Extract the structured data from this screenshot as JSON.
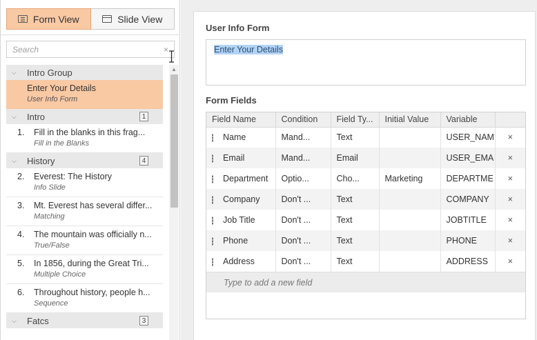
{
  "view_toggle": {
    "form_view": "Form View",
    "slide_view": "Slide View"
  },
  "search": {
    "placeholder": "Search",
    "clear": "×"
  },
  "tree": {
    "intro_group": {
      "label": "Intro Group",
      "items": [
        {
          "title": "Enter Your Details",
          "sub": "User Info Form"
        }
      ]
    },
    "intro": {
      "label": "Intro",
      "count": "1",
      "items": [
        {
          "num": "1.",
          "title": "Fill in the blanks in this frag...",
          "sub": "Fill in the Blanks"
        }
      ]
    },
    "history": {
      "label": "History",
      "count": "4",
      "items": [
        {
          "num": "2.",
          "title": "Everest: The History",
          "sub": "Info Slide"
        },
        {
          "num": "3.",
          "title": "Mt. Everest has several differ...",
          "sub": "Matching"
        },
        {
          "num": "4.",
          "title": "The mountain was officially n...",
          "sub": "True/False"
        },
        {
          "num": "5.",
          "title": "In 1856, during the Great Tri...",
          "sub": "Multiple Choice"
        },
        {
          "num": "6.",
          "title": "Throughout history, people h...",
          "sub": "Sequence"
        }
      ]
    },
    "facts": {
      "label": "Fatcs",
      "count": "3"
    }
  },
  "form": {
    "title_label": "User Info Form",
    "text_value": "Enter Your Details",
    "fields_label": "Form Fields",
    "columns": [
      "Field Name",
      "Condition",
      "Field Ty...",
      "Initial Value",
      "Variable",
      ""
    ],
    "rows": [
      {
        "name": "Name",
        "condition": "Mand...",
        "type": "Text",
        "initial": "",
        "variable": "USER_NAM"
      },
      {
        "name": "Email",
        "condition": "Mand...",
        "type": "Email",
        "initial": "",
        "variable": "USER_EMA"
      },
      {
        "name": "Department",
        "condition": "Optio...",
        "type": "Cho...",
        "initial": "Marketing",
        "variable": "DEPARTME"
      },
      {
        "name": "Company",
        "condition": "Don't ...",
        "type": "Text",
        "initial": "",
        "variable": "COMPANY"
      },
      {
        "name": "Job Title",
        "condition": "Don't ...",
        "type": "Text",
        "initial": "",
        "variable": "JOBTITLE"
      },
      {
        "name": "Phone",
        "condition": "Don't ...",
        "type": "Text",
        "initial": "",
        "variable": "PHONE"
      },
      {
        "name": "Address",
        "condition": "Don't ...",
        "type": "Text",
        "initial": "",
        "variable": "ADDRESS"
      }
    ],
    "delete_glyph": "×",
    "add_placeholder": "Type to add a new field"
  },
  "colors": {
    "accent": "#f9c9a4",
    "selection": "#b3d3f5"
  }
}
